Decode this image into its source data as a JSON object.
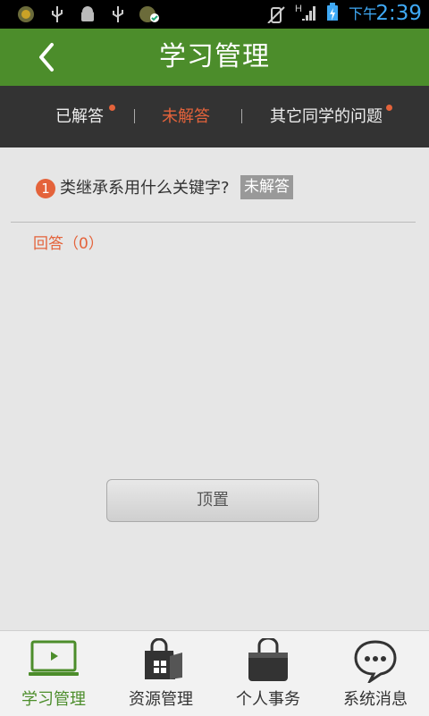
{
  "status_bar": {
    "ampm": "下午",
    "time": "2:39"
  },
  "header": {
    "title": "学习管理",
    "back_icon": "chevron-left-icon"
  },
  "tabs": [
    {
      "label": "已解答",
      "active": false,
      "has_dot": true
    },
    {
      "label": "未解答",
      "active": true,
      "has_dot": false
    },
    {
      "label": "其它同学的问题",
      "active": false,
      "has_dot": true
    }
  ],
  "question": {
    "number": "1",
    "text": "类继承系用什么关键字?",
    "status_badge": "未解答",
    "answers_label": "回答（0）"
  },
  "pin_button": {
    "label": "顶置"
  },
  "bottom_nav": [
    {
      "label": "学习管理",
      "icon": "laptop-play-icon",
      "active": true
    },
    {
      "label": "资源管理",
      "icon": "shopping-bag-windows-icon",
      "active": false
    },
    {
      "label": "个人事务",
      "icon": "briefcase-icon",
      "active": false
    },
    {
      "label": "系统消息",
      "icon": "chat-bubble-icon",
      "active": false
    }
  ],
  "colors": {
    "brand_green": "#4c8d2b",
    "accent_orange": "#e4633b",
    "tab_bar": "#333333",
    "status_blue": "#3fa9f5"
  }
}
